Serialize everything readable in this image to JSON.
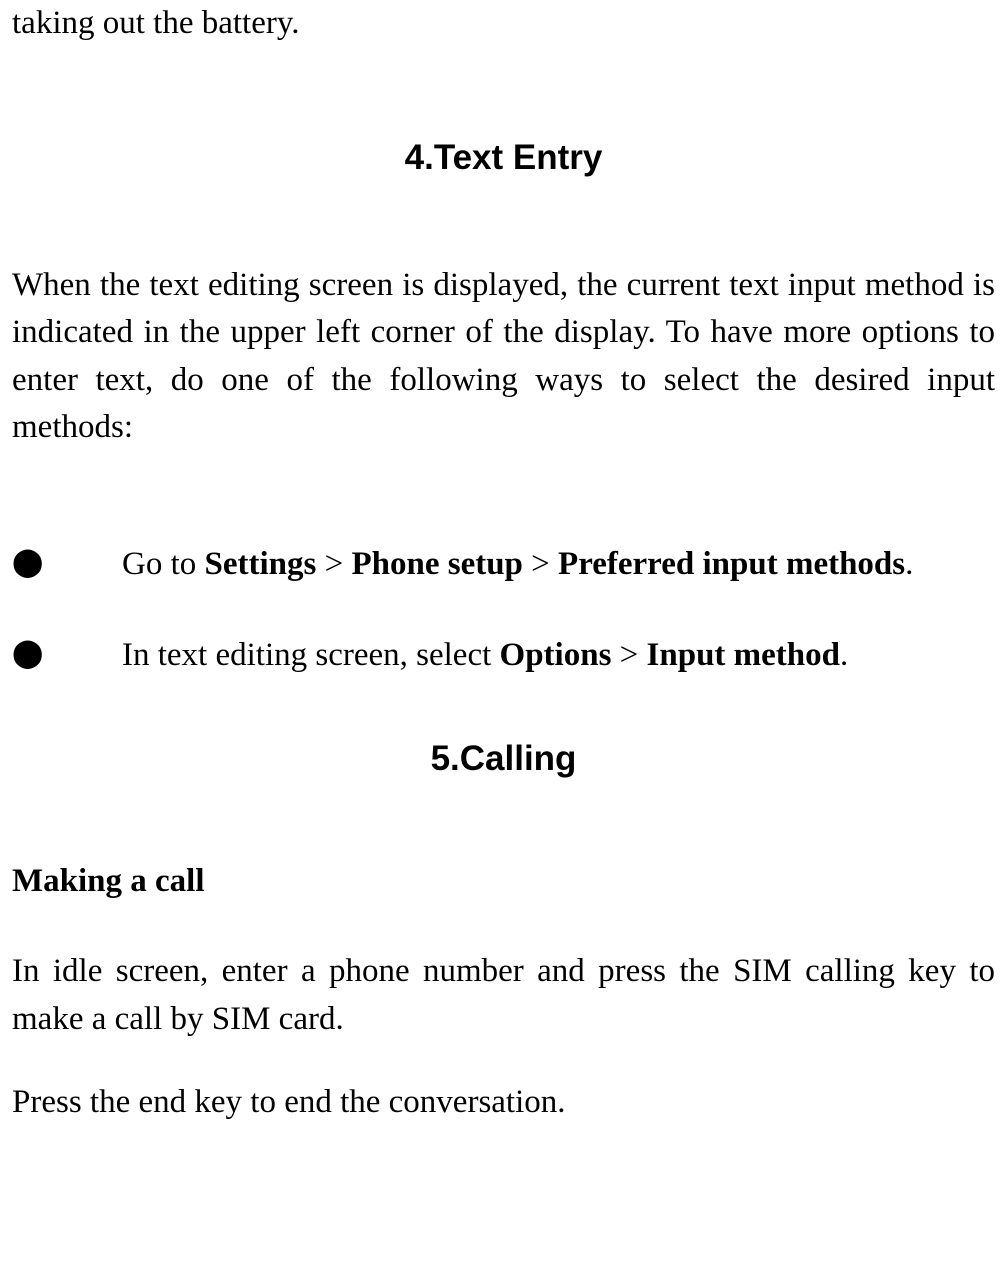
{
  "topFragment": "taking out the battery.",
  "section4": {
    "heading": "4.Text Entry",
    "intro": "When the text editing screen is displayed, the current text input method is indicated in the upper left corner of the display. To have more options to enter text, do one of the following ways to select the desired input methods:",
    "bullets": [
      {
        "pre1": "Go to ",
        "b1": "Settings",
        "sep1": " > ",
        "b2": "Phone setup",
        "sep2": " > ",
        "b3": "Preferred input methods",
        "post": "."
      },
      {
        "pre1": "In text editing screen, select ",
        "b1": "Options",
        "sep1": " > ",
        "b2": "Input method",
        "post": "."
      }
    ]
  },
  "section5": {
    "heading": "5.Calling",
    "subtitle": "Making a call",
    "para1": "In idle screen, enter a phone number and press the SIM calling key to make a call by SIM card.",
    "para2": "Press the end key to end the conversation."
  }
}
